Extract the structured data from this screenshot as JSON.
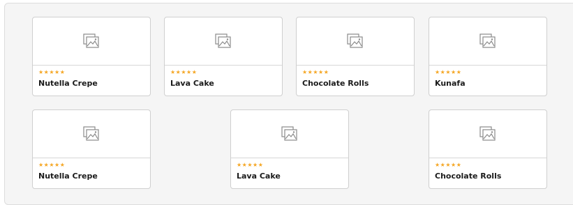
{
  "icons": {
    "placeholder": "image-placeholder-icon",
    "rating": "star-icon"
  },
  "colors": {
    "star": "#f5a623",
    "panel_bg": "#f5f5f5",
    "card_border": "#cfcfcf"
  },
  "products": [
    {
      "name": "Nutella Crepe",
      "rating": "★★★★★",
      "stars": 5
    },
    {
      "name": "Lava Cake",
      "rating": "★★★★★",
      "stars": 5
    },
    {
      "name": "Chocolate Rolls",
      "rating": "★★★★★",
      "stars": 5
    },
    {
      "name": "Kunafa",
      "rating": "★★★★★",
      "stars": 5
    },
    {
      "name": "Nutella Crepe",
      "rating": "★★★★★",
      "stars": 5
    },
    {
      "name": "Lava Cake",
      "rating": "★★★★★",
      "stars": 5
    },
    {
      "name": "Chocolate Rolls",
      "rating": "★★★★★",
      "stars": 5
    }
  ]
}
